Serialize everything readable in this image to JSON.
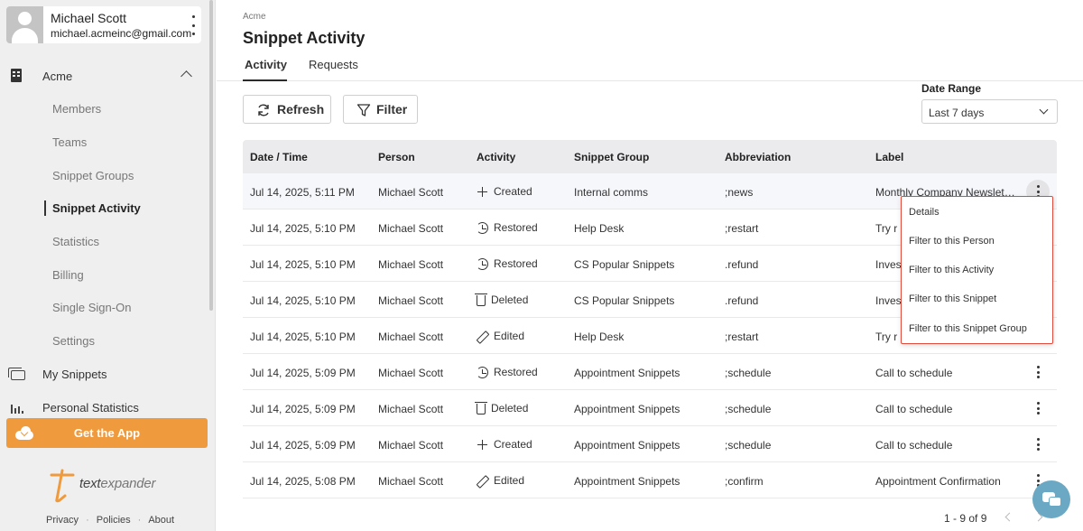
{
  "user": {
    "name": "Michael Scott",
    "email": "michael.acmeinc@gmail.com"
  },
  "org": {
    "name": "Acme"
  },
  "nav": {
    "items": [
      "Members",
      "Teams",
      "Snippet Groups",
      "Snippet Activity",
      "Statistics",
      "Billing",
      "Single Sign-On",
      "Settings"
    ],
    "active": "Snippet Activity",
    "my_snippets": "My Snippets",
    "personal_statistics": "Personal Statistics"
  },
  "get_app_label": "Get the App",
  "brand": {
    "logo_text_a": "text",
    "logo_text_b": "expander"
  },
  "footer": {
    "privacy": "Privacy",
    "policies": "Policies",
    "about": "About"
  },
  "page": {
    "breadcrumb": "Acme",
    "title": "Snippet Activity",
    "tabs": [
      "Activity",
      "Requests"
    ],
    "active_tab": "Activity"
  },
  "toolbar": {
    "refresh_label": "Refresh",
    "filter_label": "Filter"
  },
  "date_range": {
    "label": "Date Range",
    "value": "Last 7 days"
  },
  "table": {
    "columns": [
      "Date / Time",
      "Person",
      "Activity",
      "Snippet Group",
      "Abbreviation",
      "Label"
    ],
    "rows": [
      {
        "datetime": "Jul 14, 2025, 5:11 PM",
        "person": "Michael Scott",
        "activity": "Created",
        "activity_icon": "plus-icon",
        "group": "Internal comms",
        "abbr": ";news",
        "label": "Monthly Company Newslet…"
      },
      {
        "datetime": "Jul 14, 2025, 5:10 PM",
        "person": "Michael Scott",
        "activity": "Restored",
        "activity_icon": "restore-icon",
        "group": "Help Desk",
        "abbr": ";restart",
        "label": "Try r"
      },
      {
        "datetime": "Jul 14, 2025, 5:10 PM",
        "person": "Michael Scott",
        "activity": "Restored",
        "activity_icon": "restore-icon",
        "group": "CS Popular Snippets",
        "abbr": ".refund",
        "label": "Inves"
      },
      {
        "datetime": "Jul 14, 2025, 5:10 PM",
        "person": "Michael Scott",
        "activity": "Deleted",
        "activity_icon": "trash-icon",
        "group": "CS Popular Snippets",
        "abbr": ".refund",
        "label": "Inves"
      },
      {
        "datetime": "Jul 14, 2025, 5:10 PM",
        "person": "Michael Scott",
        "activity": "Edited",
        "activity_icon": "pencil-icon",
        "group": "Help Desk",
        "abbr": ";restart",
        "label": "Try r"
      },
      {
        "datetime": "Jul 14, 2025, 5:09 PM",
        "person": "Michael Scott",
        "activity": "Restored",
        "activity_icon": "restore-icon",
        "group": "Appointment Snippets",
        "abbr": ";schedule",
        "label": "Call to schedule"
      },
      {
        "datetime": "Jul 14, 2025, 5:09 PM",
        "person": "Michael Scott",
        "activity": "Deleted",
        "activity_icon": "trash-icon",
        "group": "Appointment Snippets",
        "abbr": ";schedule",
        "label": "Call to schedule"
      },
      {
        "datetime": "Jul 14, 2025, 5:09 PM",
        "person": "Michael Scott",
        "activity": "Created",
        "activity_icon": "plus-icon",
        "group": "Appointment Snippets",
        "abbr": ";schedule",
        "label": "Call to schedule"
      },
      {
        "datetime": "Jul 14, 2025, 5:08 PM",
        "person": "Michael Scott",
        "activity": "Edited",
        "activity_icon": "pencil-icon",
        "group": "Appointment Snippets",
        "abbr": ";confirm",
        "label": "Appointment Confirmation"
      }
    ]
  },
  "context_menu": {
    "items": [
      "Details",
      "Filter to this Person",
      "Filter to this Activity",
      "Filter to this Snippet",
      "Filter to this Snippet Group"
    ]
  },
  "pagination": {
    "text": "1 - 9 of 9"
  },
  "colors": {
    "accent_orange": "#f09a3e",
    "menu_highlight_border": "#e24b3b",
    "chat_fab": "#6ba8c3"
  }
}
